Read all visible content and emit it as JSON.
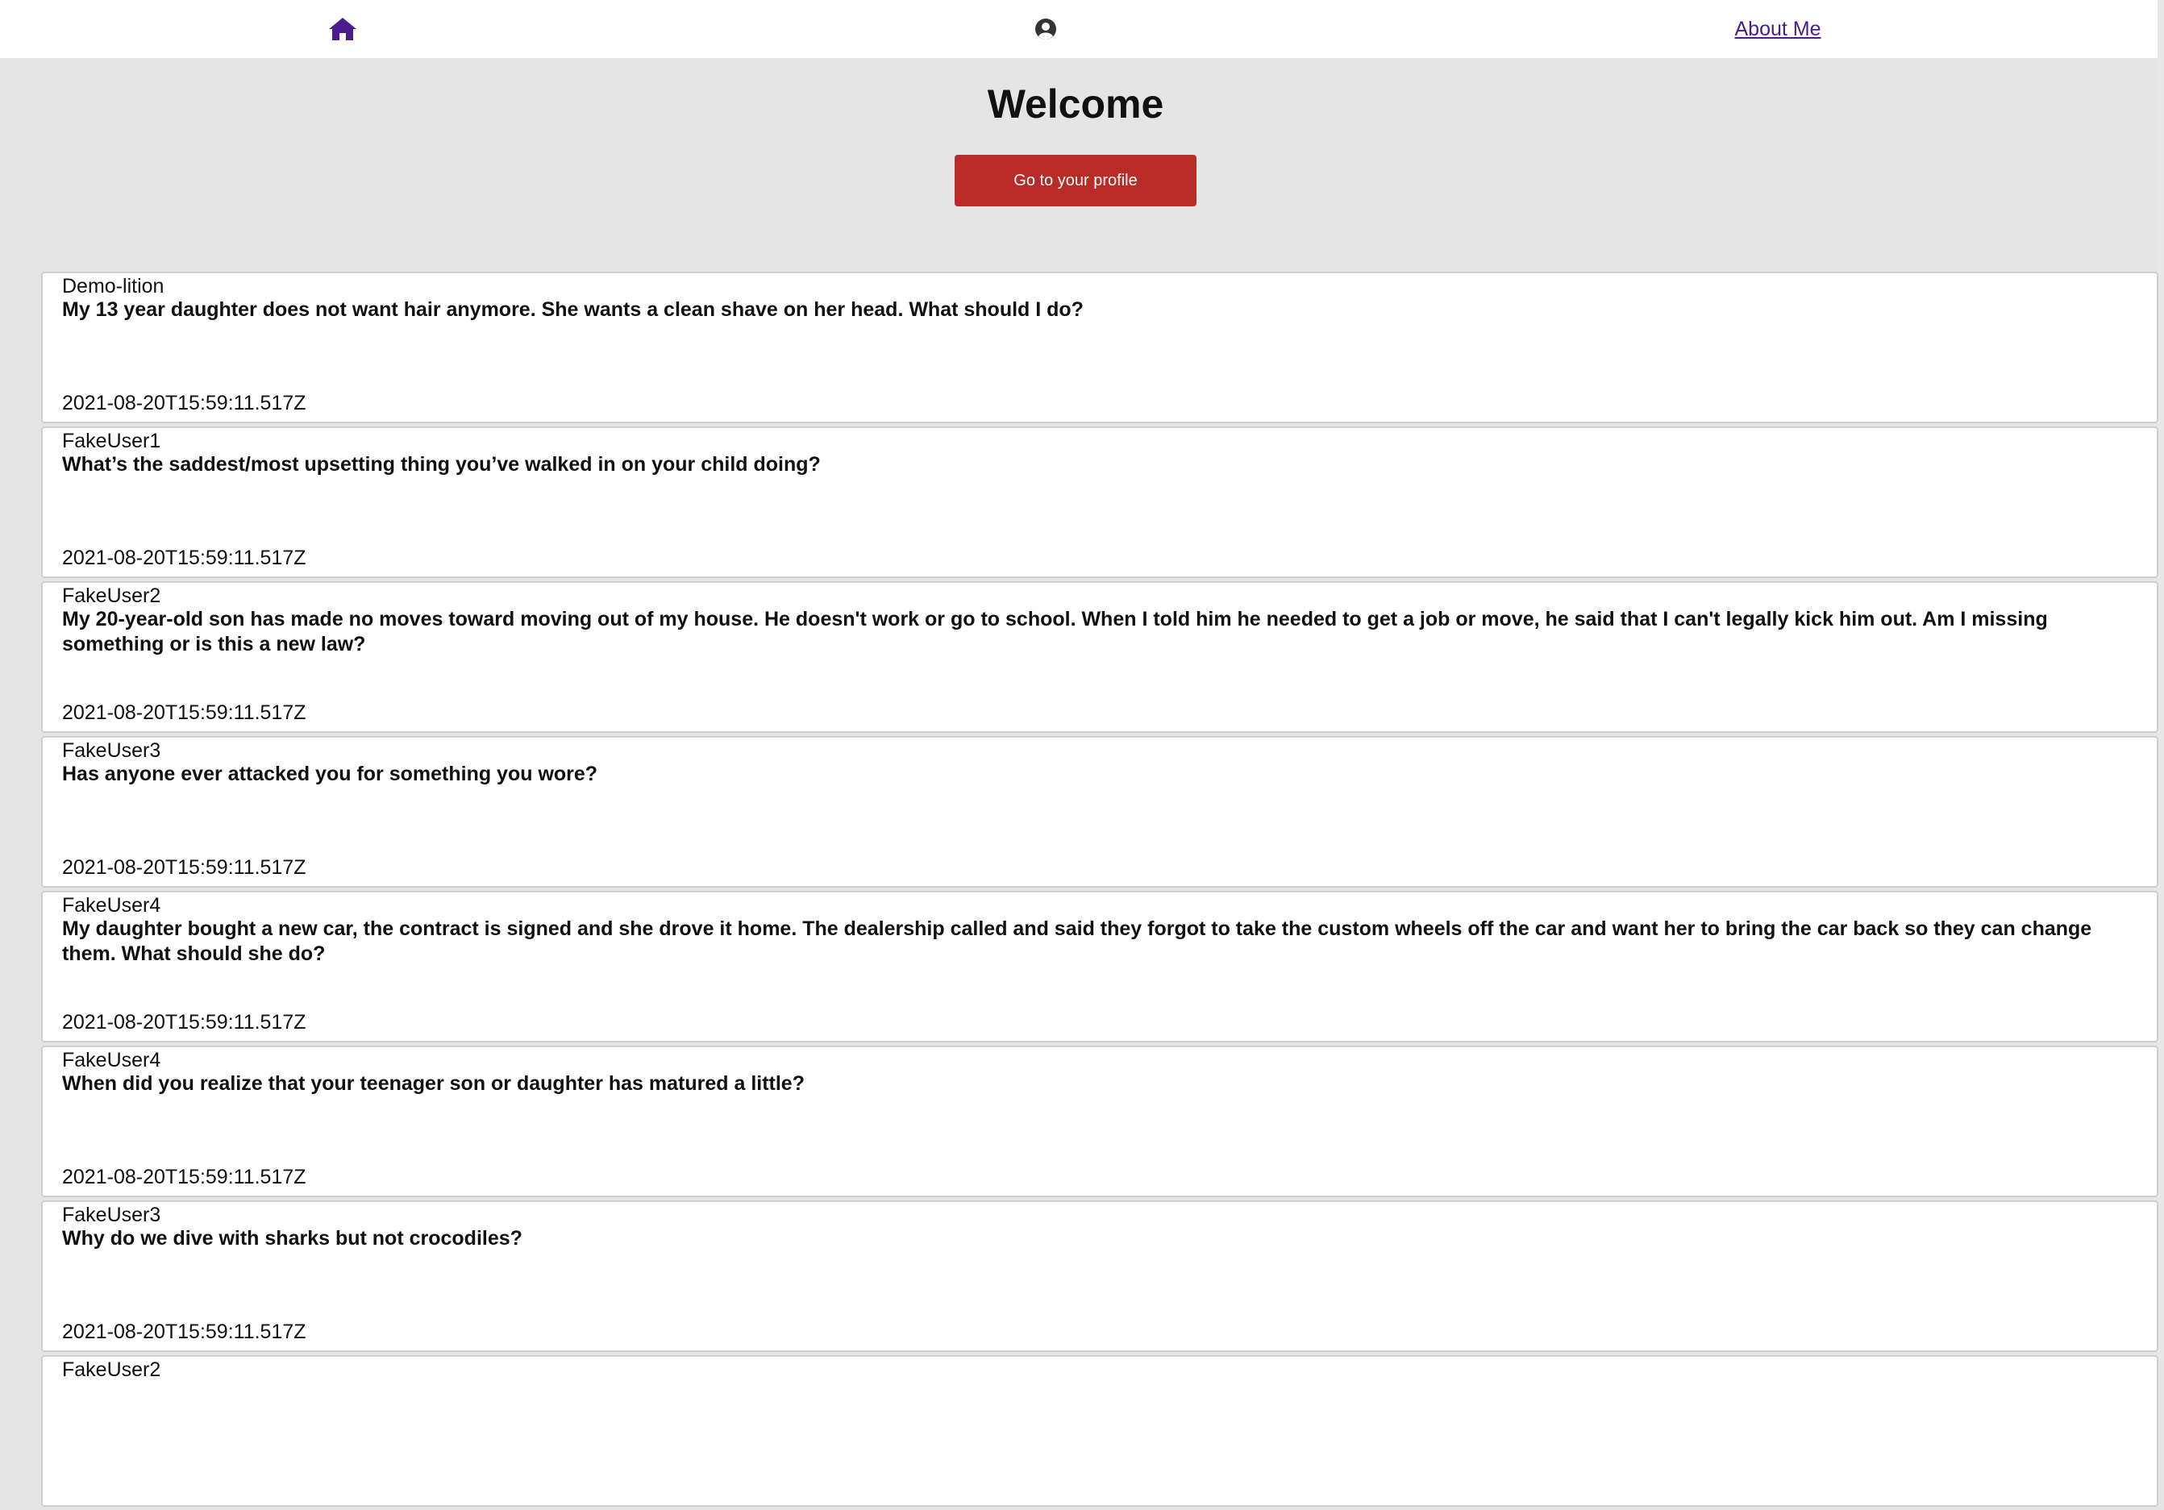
{
  "nav": {
    "home_icon": "home-icon",
    "profile_icon": "user-circle-icon",
    "about_label": "About Me",
    "home_color": "#4b1c8c"
  },
  "main": {
    "title": "Welcome",
    "profile_button_label": "Go to your profile",
    "button_color": "#b92b27"
  },
  "posts": [
    {
      "author": "Demo-lition",
      "question": "My 13 year daughter does not want hair anymore. She wants a clean shave on her head. What should I do?",
      "timestamp": "2021-08-20T15:59:11.517Z"
    },
    {
      "author": "FakeUser1",
      "question": "What’s the saddest/most upsetting thing you’ve walked in on your child doing?",
      "timestamp": "2021-08-20T15:59:11.517Z"
    },
    {
      "author": "FakeUser2",
      "question": "My 20-year-old son has made no moves toward moving out of my house. He doesn't work or go to school. When I told him he needed to get a job or move, he said that I can't legally kick him out. Am I missing something or is this a new law?",
      "timestamp": "2021-08-20T15:59:11.517Z"
    },
    {
      "author": "FakeUser3",
      "question": "Has anyone ever attacked you for something you wore?",
      "timestamp": "2021-08-20T15:59:11.517Z"
    },
    {
      "author": "FakeUser4",
      "question": "My daughter bought a new car, the contract is signed and she drove it home. The dealership called and said they forgot to take the custom wheels off the car and want her to bring the car back so they can change them. What should she do?",
      "timestamp": "2021-08-20T15:59:11.517Z"
    },
    {
      "author": "FakeUser4",
      "question": "When did you realize that your teenager son or daughter has matured a little?",
      "timestamp": "2021-08-20T15:59:11.517Z"
    },
    {
      "author": "FakeUser3",
      "question": "Why do we dive with sharks but not crocodiles?",
      "timestamp": "2021-08-20T15:59:11.517Z"
    },
    {
      "author": "FakeUser2",
      "question": "",
      "timestamp": ""
    }
  ]
}
